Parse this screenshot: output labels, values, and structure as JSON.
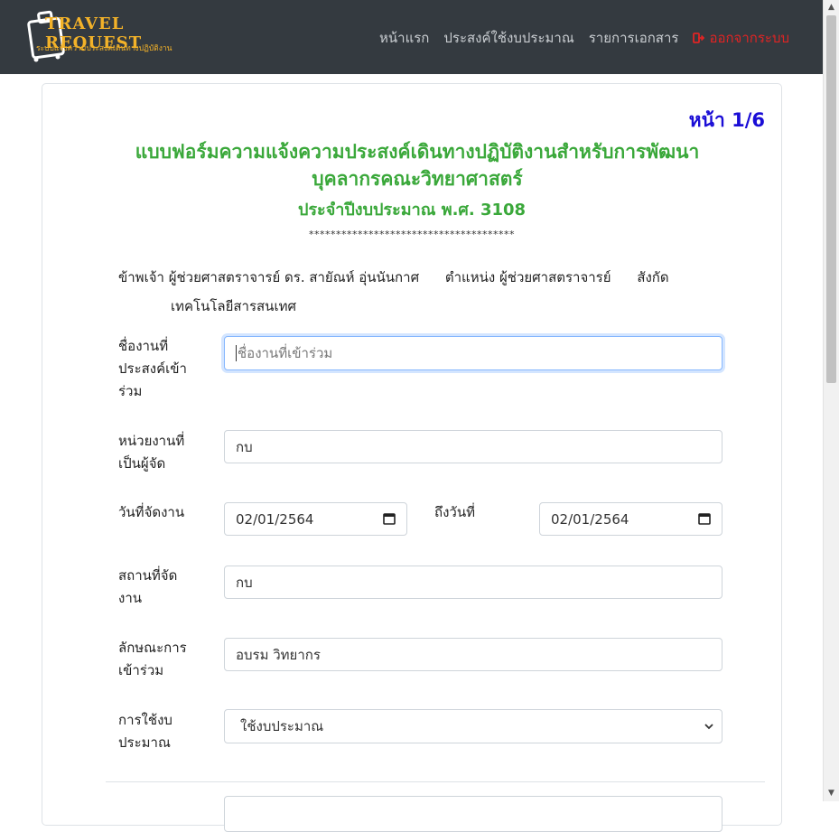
{
  "brand": {
    "title": "TRAVEL REQUEST",
    "subtitle": "ระบบแจ้งความประสงค์เดินทางปฏิบัติงาน"
  },
  "nav": {
    "home": "หน้าแรก",
    "budget": "ประสงค์ใช้งบประมาณ",
    "documents": "รายการเอกสาร",
    "logout": "ออกจากระบบ"
  },
  "form": {
    "page_indicator": "หน้า 1/6",
    "title": "แบบฟอร์มความแจ้งความประสงค์เดินทางปฏิบัติงานสำหรับการพัฒนาบุคลากรคณะวิทยาศาสตร์",
    "fiscal_year": "ประจำปีงบประมาณ พ.ศ. 3108",
    "stars": "**************************************",
    "intro": {
      "i_am_label": "ข้าพเจ้า",
      "name": "ผู้ช่วยศาสตราจารย์ ดร.  สายัณห์  อุ่นนันกาศ",
      "position_label": "ตำแหน่ง",
      "position": "ผู้ช่วยศาสตราจารย์",
      "affiliation_label": "สังกัด",
      "affiliation": "เทคโนโลยีสารสนเทศ"
    },
    "event_name": {
      "label": "ชื่องานที่ประสงค์เข้าร่วม",
      "value": "",
      "placeholder": "ชื่องานที่เข้าร่วม"
    },
    "organizer": {
      "label": "หน่วยงานที่เป็นผู้จัด",
      "value": "กบ"
    },
    "start_date": {
      "label": "วันที่จัดงาน",
      "value": "02/01/2564"
    },
    "end_date": {
      "label": "ถึงวันที่",
      "value": "02/01/2564"
    },
    "venue": {
      "label": "สถานที่จัดงาน",
      "value": "กบ"
    },
    "participation": {
      "label": "ลักษณะการเข้าร่วม",
      "value": "อบรม วิทยากร"
    },
    "budget_use": {
      "label": "การใช้งบประมาณ",
      "selected": "ใช้งบประมาณ"
    }
  },
  "icons": {
    "logout": "sign-out-icon",
    "calendar": "calendar-icon",
    "dropdown": "chevron-down-icon",
    "logo": "suitcase-icon"
  },
  "colors": {
    "navbar": "#343a40",
    "brand": "#f3b229",
    "title_green": "#3aa83a",
    "page_blue": "#1a0dd6",
    "logout_red": "#e02424"
  }
}
